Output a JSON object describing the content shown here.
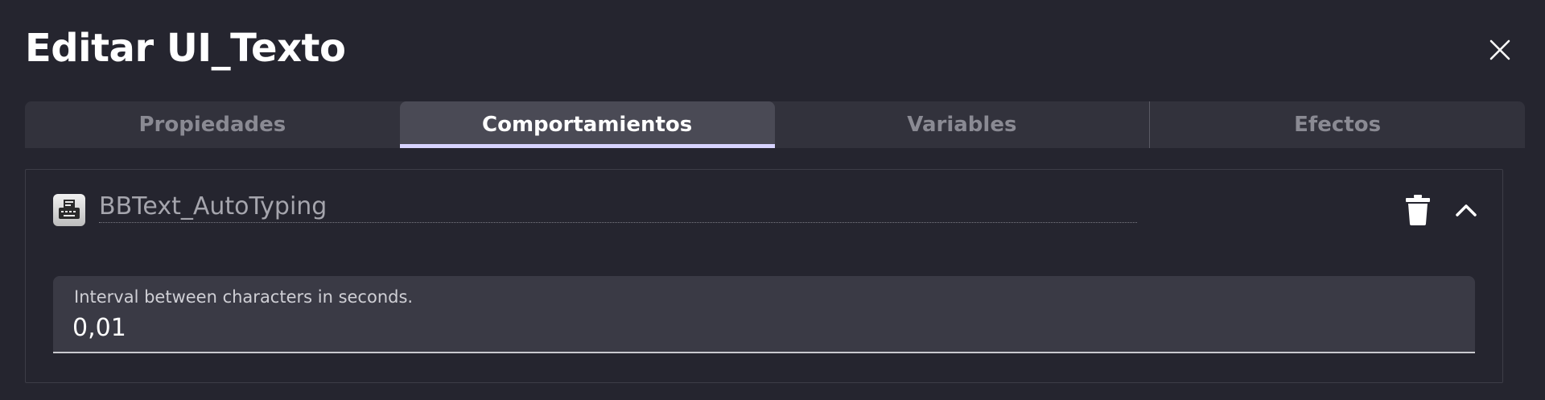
{
  "dialog": {
    "title": "Editar UI_Texto"
  },
  "tabs": [
    {
      "label": "Propiedades",
      "active": false
    },
    {
      "label": "Comportamientos",
      "active": true
    },
    {
      "label": "Variables",
      "active": false
    },
    {
      "label": "Efectos",
      "active": false
    }
  ],
  "behavior": {
    "name": "BBText_AutoTyping",
    "icon": "typewriter-icon",
    "field": {
      "label": "Interval between characters in seconds.",
      "value": "0,01"
    }
  },
  "icons": {
    "close": "close-icon",
    "delete": "trash-icon",
    "collapse": "chevron-up-icon"
  },
  "colors": {
    "background": "#25252f",
    "tab_bar": "#32323c",
    "tab_active": "#4a4a55",
    "tab_indicator": "#d8d4ff",
    "field_background": "#3a3a45"
  }
}
